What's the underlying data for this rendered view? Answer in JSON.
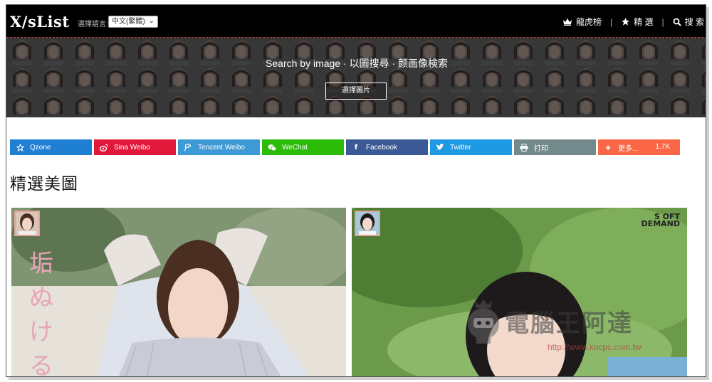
{
  "header": {
    "logo": "X/sList",
    "lang_label": "選擇語言:",
    "lang_selected": "中文(繁體)",
    "nav": [
      {
        "icon": "crown-icon",
        "label": "龍虎榜"
      },
      {
        "icon": "star-icon",
        "label": "精 選"
      },
      {
        "icon": "search-icon",
        "label": "搜 索"
      }
    ]
  },
  "banner": {
    "title": "Search by image · 以圖搜尋 · 颜画像検索",
    "button": "選擇圖片"
  },
  "share": [
    {
      "name": "qzone",
      "label": "Qzone",
      "color": "#1e7fd3",
      "icon": "star-icon"
    },
    {
      "name": "sina-weibo",
      "label": "Sina Weibo",
      "color": "#e2183a",
      "icon": "weibo-icon"
    },
    {
      "name": "tencent-weibo",
      "label": "Tencent Weibo",
      "color": "#3e9ad6",
      "icon": "tencent-icon"
    },
    {
      "name": "wechat",
      "label": "WeChat",
      "color": "#2bbc07",
      "icon": "wechat-icon"
    },
    {
      "name": "facebook",
      "label": "Facebook",
      "color": "#3c5997",
      "icon": "facebook-icon"
    },
    {
      "name": "twitter",
      "label": "Twitter",
      "color": "#1d9ae3",
      "icon": "twitter-icon"
    },
    {
      "name": "print",
      "label": "打印",
      "color": "#738a8d",
      "icon": "print-icon"
    },
    {
      "name": "more",
      "label": "更多...",
      "color": "#fb6746",
      "icon": "plus-icon",
      "count": "1.7K"
    }
  ],
  "section": {
    "title": "精選美圖"
  },
  "cards": {
    "card1": {
      "vertical_text": "垢ぬける"
    },
    "card2": {
      "brand_top": "S OFT",
      "brand_bottom": "DEMAND"
    }
  },
  "watermark": {
    "text": "電腦王阿達",
    "url": "http://www.kocpc.com.tw"
  }
}
